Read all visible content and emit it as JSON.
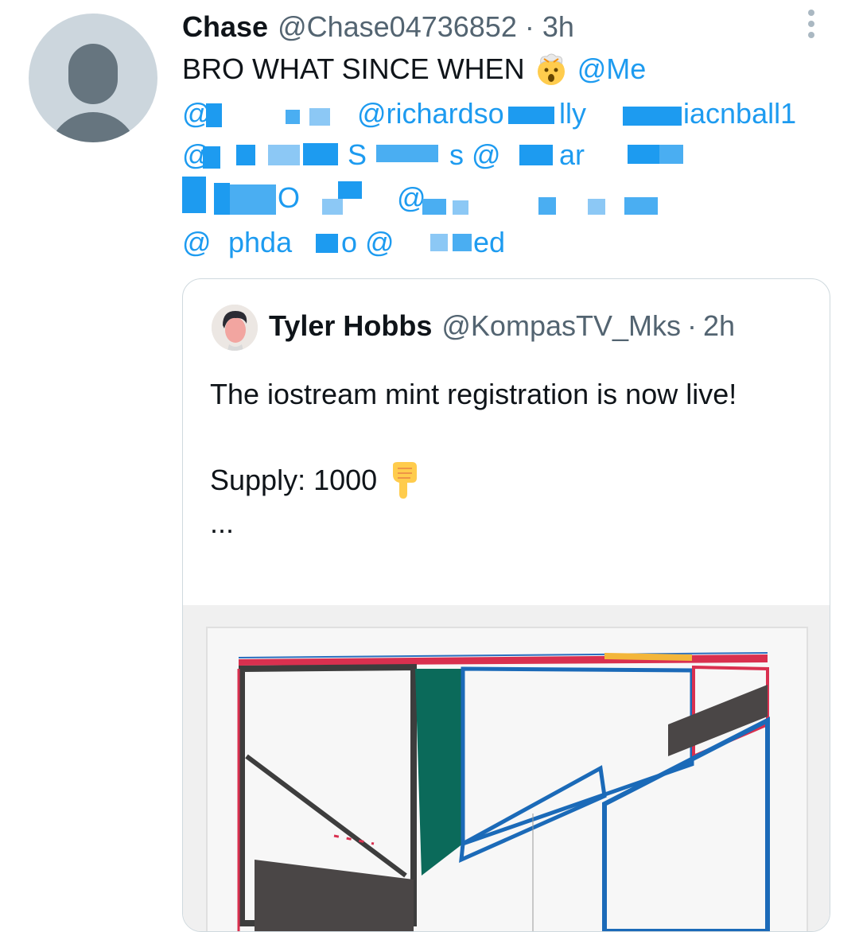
{
  "author": {
    "name": "Chase",
    "handle": "@Chase04736852",
    "separator": "·",
    "time": "3h"
  },
  "tweet": {
    "text": "BRO WHAT SINCE WHEN",
    "emoji": "exploding-head-emoji",
    "first_mention": "@Me"
  },
  "mentions": {
    "line1": [
      "@",
      "@richardso",
      "lly",
      "iacnball1"
    ],
    "line2": [
      "@",
      "S",
      "s @",
      "ar"
    ],
    "line3": [
      "O",
      "@"
    ],
    "line4": [
      "@",
      "phda",
      "o @",
      "ed"
    ]
  },
  "quoted": {
    "name": "Tyler Hobbs",
    "handle": "@KompasTV_Mks",
    "separator": "·",
    "time": "2h",
    "text_line1": "The iostream mint registration is now live!",
    "supply_text": "Supply: 1000",
    "supply_emoji": "pointing-down-emoji",
    "ellipsis": "..."
  },
  "colors": {
    "link": "#1d9bf0",
    "secondary_text": "#536471",
    "border": "#cfd9de"
  }
}
